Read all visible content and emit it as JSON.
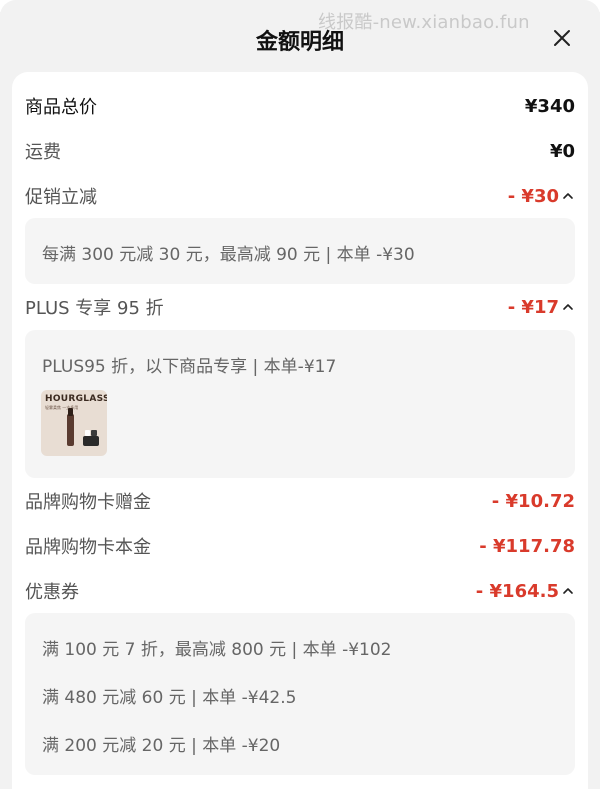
{
  "watermark": "线报酷-new.xianbao.fun",
  "header": {
    "title": "金额明细"
  },
  "rows": {
    "total": {
      "label": "商品总价",
      "amount": "¥340"
    },
    "shipping": {
      "label": "运费",
      "amount": "¥0"
    },
    "promo": {
      "label": "促销立减",
      "amount": "- ¥30"
    },
    "plus": {
      "label": "PLUS 专享 95 折",
      "amount": "- ¥17"
    },
    "gift_card_bonus": {
      "label": "品牌购物卡赠金",
      "amount": "- ¥10.72"
    },
    "gift_card_principal": {
      "label": "品牌购物卡本金",
      "amount": "- ¥117.78"
    },
    "coupons": {
      "label": "优惠券",
      "amount": "- ¥164.5"
    }
  },
  "details": {
    "promo_line": "每满 300 元减 30 元，最高减 90 元 | 本单 -¥30",
    "plus_line": "PLUS95 折，以下商品专享 | 本单-¥17",
    "product": {
      "brand": "HOURGLASS",
      "subtitle": "轻雾柔焦 一支多用"
    },
    "coupon_lines": [
      "满 100 元 7 折，最高减 800 元 | 本单 -¥102",
      "满 480 元减 60 元 | 本单 -¥42.5",
      "满 200 元减 20 元 | 本单 -¥20"
    ]
  },
  "colors": {
    "accent_red": "#d93a2b",
    "background": "#f2f2f2",
    "card": "#ffffff"
  },
  "icons": {
    "close": "close-icon",
    "collapse": "chevron-up-icon"
  }
}
